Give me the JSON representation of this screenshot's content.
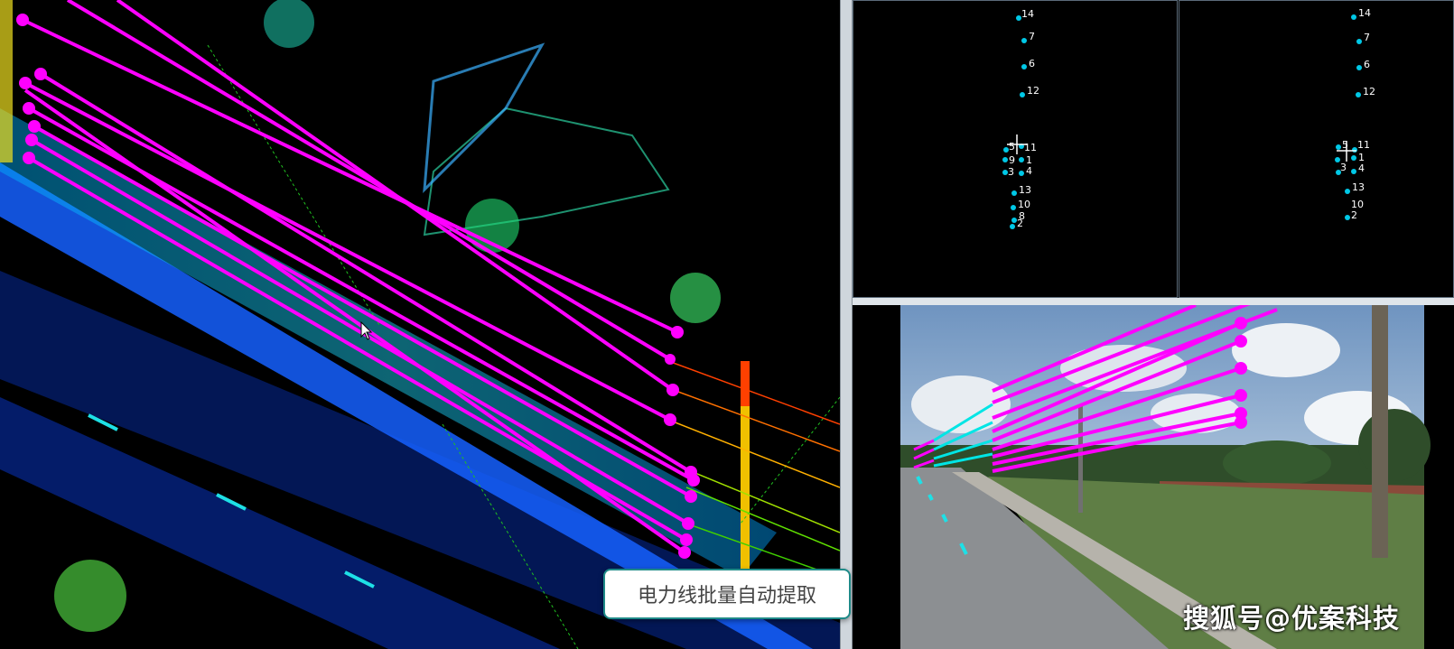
{
  "viewer": {
    "tooltip_text": "电力线批量自动提取",
    "watermark_text": "搜狐号@优案科技"
  },
  "cross_section_left": {
    "points": [
      {
        "label": "14"
      },
      {
        "label": "7"
      },
      {
        "label": "6"
      },
      {
        "label": "12"
      },
      {
        "label": "5"
      },
      {
        "label": "11"
      },
      {
        "label": "9"
      },
      {
        "label": "1"
      },
      {
        "label": "3"
      },
      {
        "label": "4"
      },
      {
        "label": "13"
      },
      {
        "label": "10"
      },
      {
        "label": "8"
      },
      {
        "label": "2"
      }
    ]
  },
  "cross_section_right": {
    "points": [
      {
        "label": "14"
      },
      {
        "label": "7"
      },
      {
        "label": "6"
      },
      {
        "label": "12"
      },
      {
        "label": "5"
      },
      {
        "label": "11"
      },
      {
        "label": "1"
      },
      {
        "label": "3"
      },
      {
        "label": "4"
      },
      {
        "label": "13"
      },
      {
        "label": "10"
      },
      {
        "label": "2"
      }
    ]
  },
  "colors": {
    "powerline_extracted": "#ff00ff",
    "powerline_projected": "#00e5e5",
    "point_marker": "#00c8e6",
    "tooltip_border": "#1f8a88"
  }
}
